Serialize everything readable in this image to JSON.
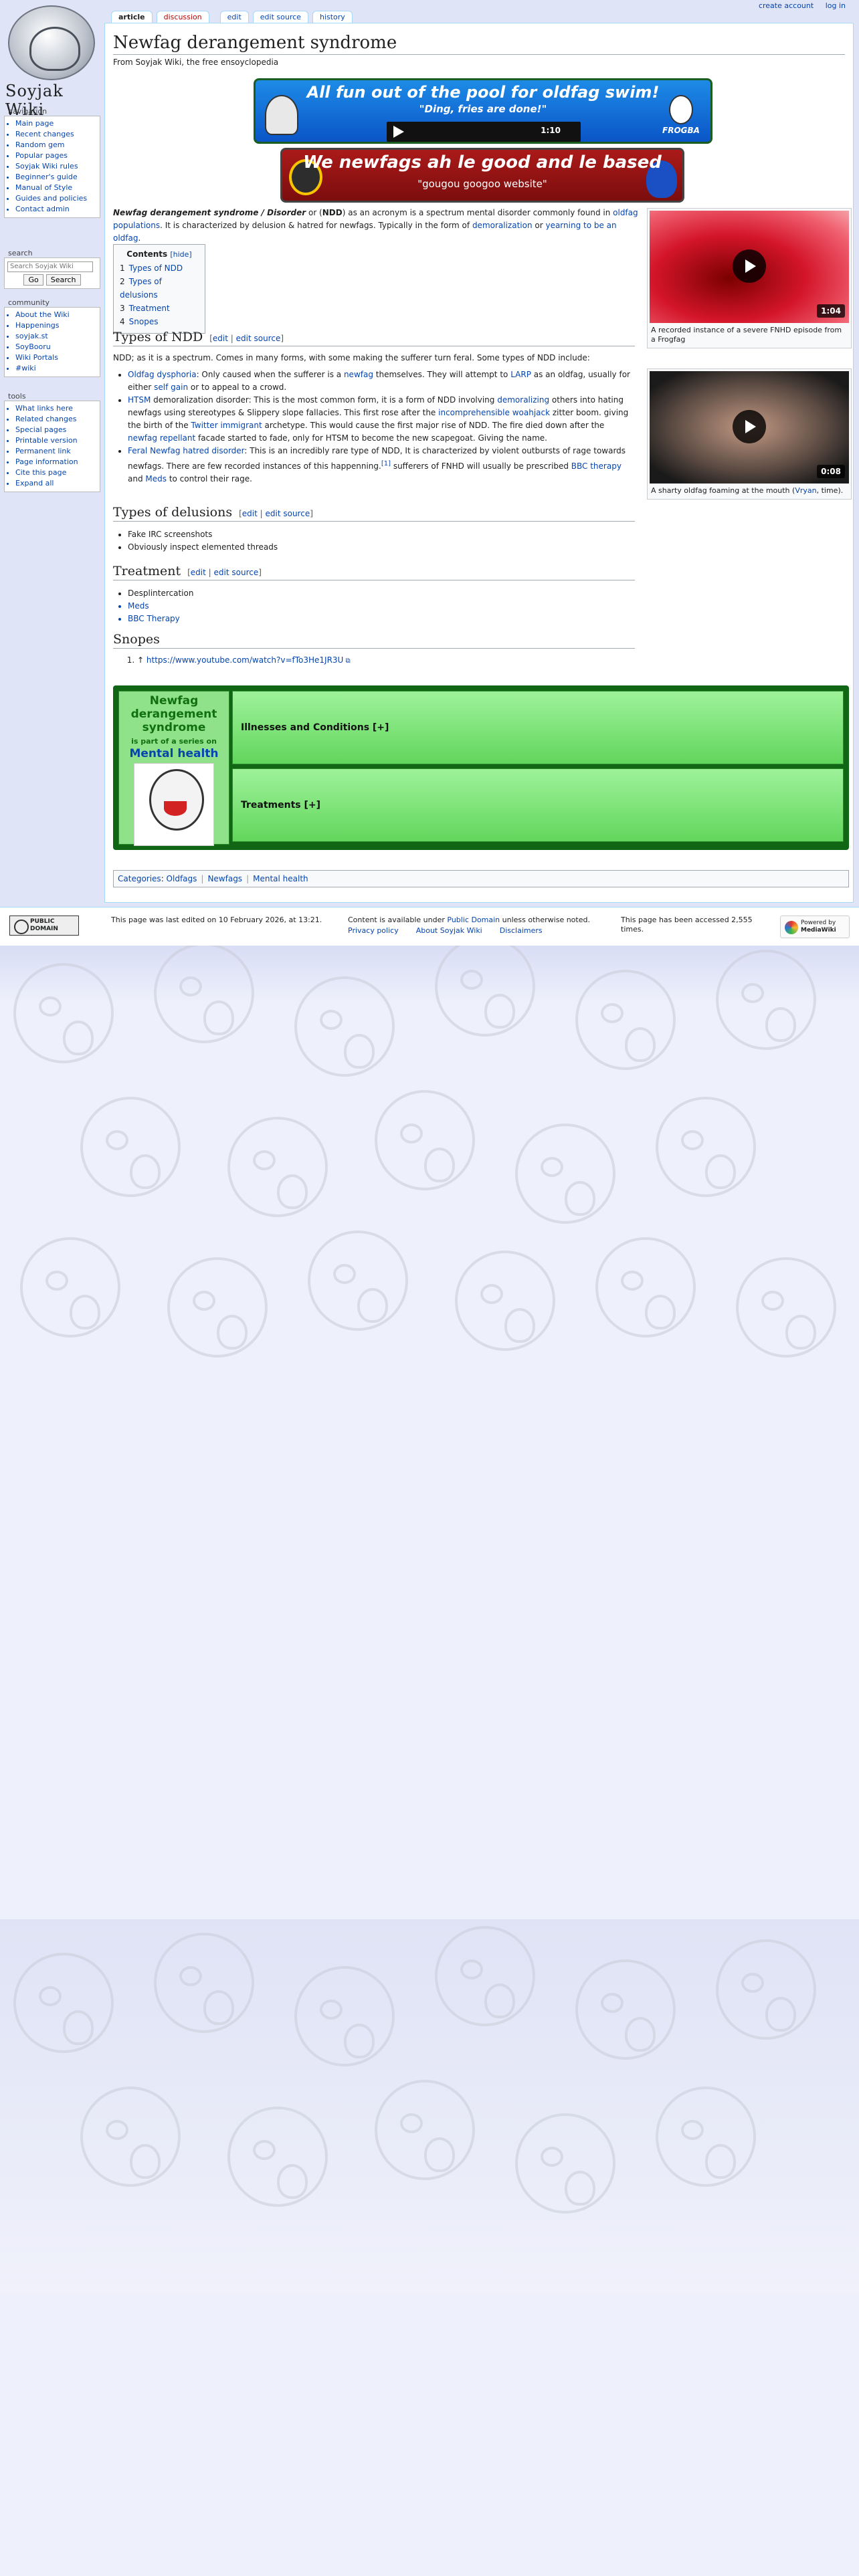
{
  "personal": {
    "create": "create account",
    "login": "log in"
  },
  "tabs": {
    "article": "article",
    "discussion": "discussion",
    "edit": "edit",
    "edit_source": "edit source",
    "history": "history"
  },
  "logo": {
    "text": "Soyjak Wiki"
  },
  "nav": {
    "heading": "navigation",
    "items": [
      "Main page",
      "Recent changes",
      "Random gem",
      "Popular pages",
      "Soyjak Wiki rules",
      "Beginner's guide",
      "Manual of Style",
      "Guides and policies",
      "Contact admin"
    ]
  },
  "search": {
    "heading": "search",
    "placeholder": "Search Soyjak Wiki",
    "go": "Go",
    "search": "Search"
  },
  "community": {
    "heading": "community",
    "items": [
      "About the Wiki",
      "Happenings",
      "soyjak.st",
      "SoyBooru",
      "Wiki Portals",
      "#wiki"
    ]
  },
  "tools": {
    "heading": "tools",
    "items": [
      "What links here",
      "Related changes",
      "Special pages",
      "Printable version",
      "Permanent link",
      "Page information",
      "Cite this page",
      "Expand all"
    ]
  },
  "page": {
    "title": "Newfag derangement syndrome",
    "tagline": "From Soyjak Wiki, the free ensoyclopedia"
  },
  "banner1": {
    "line1": "All fun out of the pool for oldfag swim!",
    "line2": "\"Ding, fries are done!\"",
    "time": "1:10",
    "badge": "FROGBA"
  },
  "banner2": {
    "line1": "We newfags ah le good and le based",
    "line2": "\"gougou googoo website\""
  },
  "lead": {
    "b1": "Newfag derangement syndrome",
    "sep": " / ",
    "b2": "Disorder",
    "t1": " or (",
    "b3": "NDD",
    "t2": ") as an acronym is a spectrum mental disorder commonly found in ",
    "l1": "oldfag populations",
    "t3": ". It is characterized by delusion & hatred for newfags. Typically in the form of ",
    "l2": "demoralization",
    "t4": " or ",
    "l3": "yearning to be an oldfag",
    "t5": "."
  },
  "toc": {
    "title": "Contents",
    "hide": "[hide]",
    "items": [
      {
        "n": "1",
        "t": "Types of NDD"
      },
      {
        "n": "2",
        "t": "Types of delusions"
      },
      {
        "n": "3",
        "t": "Treatment"
      },
      {
        "n": "4",
        "t": "Snopes"
      }
    ]
  },
  "edit_links": {
    "open": "[",
    "edit": "edit",
    "bar": " | ",
    "source": "edit source",
    "close": "]"
  },
  "sec1": {
    "title": "Types of NDD",
    "intro": "NDD; as it is a spectrum. Comes in many forms, with some making the sufferer turn feral. Some types of NDD include:",
    "i1": {
      "l1": "Oldfag dysphoria",
      "t1": ": Only caused when the sufferer is a ",
      "l2": "newfag",
      "t2": " themselves. They will attempt to ",
      "l3": "LARP",
      "t3": " as an oldfag, usually for either ",
      "l4": "self gain",
      "t4": " or to appeal to a crowd."
    },
    "i2": {
      "l1": "HTSM",
      "t1": " demoralization disorder: This is the most common form, it is a form of NDD involving ",
      "l2": "demoralizing",
      "t2": " others into hating newfags using stereotypes & Slippery slope fallacies. This first rose after the ",
      "l3": "incomprehensible woahjack",
      "t3": " zitter boom. giving the birth of the ",
      "l4": "Twitter immigrant",
      "t4": " archetype. This would cause the first major rise of NDD. The fire died down after the ",
      "l5": "newfag repellant",
      "t5": " facade started to fade, only for HTSM to become the new scapegoat. Giving the name."
    },
    "i3": {
      "l1": "Feral Newfag hatred disorder",
      "t1": ": This is an incredibly rare type of NDD, It is characterized by violent outbursts of rage towards newfags. There are few recorded instances of this happenning.",
      "ref": "[1]",
      "t2": " sufferers of FNHD will usually be prescribed ",
      "l2": "BBC therapy",
      "t3": " and ",
      "l3": "Meds",
      "t4": " to control their rage."
    }
  },
  "sec2": {
    "title": "Types of delusions",
    "items": [
      "Fake IRC screenshots",
      "Obviously inspect elemented threads"
    ]
  },
  "sec3": {
    "title": "Treatment",
    "items": [
      "Desplintercation",
      "Meds",
      "BBC Therapy"
    ]
  },
  "sec4": {
    "title": "Snopes",
    "ref": "↑",
    "url": "https://www.youtube.com/watch?v=fTo3He1JR3U"
  },
  "thumb1": {
    "duration": "1:04",
    "caption": "A recorded instance of a severe FNHD episode from a Frogfag"
  },
  "thumb2": {
    "duration": "0:08",
    "caption_a": "A sharty oldfag foaming at the mouth (",
    "caption_link": "Vryan",
    "caption_b": ", time)."
  },
  "navbox": {
    "title": "Newfag derangement syndrome",
    "series": "is part of a series on",
    "topic": "Mental health",
    "row1": "Illnesses and Conditions [+]",
    "row2": "Treatments [+]"
  },
  "cats": {
    "label": "Categories",
    "items": [
      "Oldfags",
      "Newfags",
      "Mental health"
    ]
  },
  "footer": {
    "badge": "PUBLIC DOMAIN",
    "edited": "This page was last edited on 10 February 2026, at 13:21.",
    "license_a": "Content is available under ",
    "license_link": "Public Domain",
    "license_b": " unless otherwise noted.",
    "privacy": "Privacy policy",
    "about": "About Soyjak Wiki",
    "disclaimers": "Disclaimers",
    "accessed": "This page has been accessed 2,555 times.",
    "powered": "Powered by",
    "mw": "MediaWiki"
  },
  "colors": {
    "link": "#0645ad",
    "navbox": "#116616",
    "banner1": "#0b55c8",
    "banner2": "#ab1a1a"
  }
}
